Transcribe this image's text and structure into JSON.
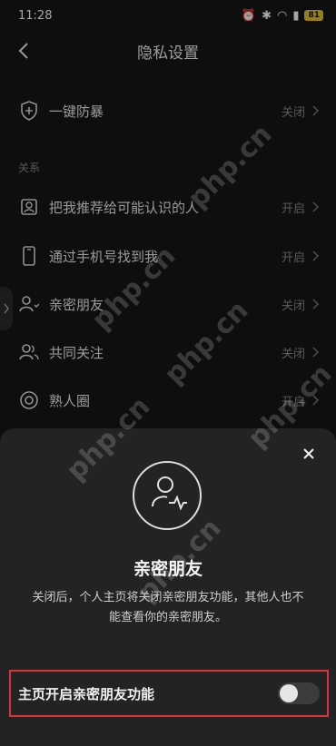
{
  "status": {
    "time": "11:28",
    "battery": "81"
  },
  "nav": {
    "title": "隐私设置"
  },
  "rows": [
    {
      "label": "一键防暴",
      "value": "关闭"
    },
    {
      "label": "把我推荐给可能认识的人",
      "value": "开启"
    },
    {
      "label": "通过手机号找到我",
      "value": "开启"
    },
    {
      "label": "亲密朋友",
      "value": "关闭"
    },
    {
      "label": "共同关注",
      "value": "关闭"
    },
    {
      "label": "熟人圈",
      "value": "开启"
    }
  ],
  "section": {
    "relations": "关系"
  },
  "sheet": {
    "title": "亲密朋友",
    "description": "关闭后，个人主页将关闭亲密朋友功能，其他人也不能查看你的亲密朋友。",
    "toggle_label": "主页开启亲密朋友功能",
    "toggle_state": false
  },
  "watermark": "php.cn"
}
